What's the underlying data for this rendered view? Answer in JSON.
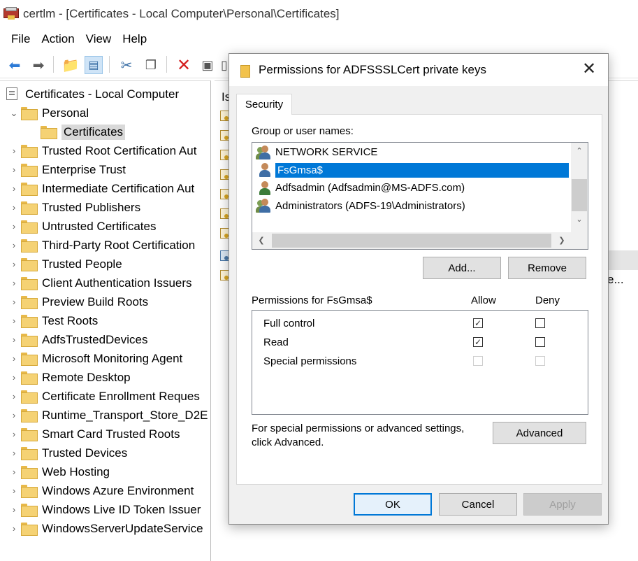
{
  "window": {
    "title": "certlm - [Certificates - Local Computer\\Personal\\Certificates]"
  },
  "menu": [
    "File",
    "Action",
    "View",
    "Help"
  ],
  "tree": {
    "root": "Certificates - Local Computer",
    "personal": "Personal",
    "personal_child": "Certificates",
    "folders": [
      "Trusted Root Certification Aut",
      "Enterprise Trust",
      "Intermediate Certification Aut",
      "Trusted Publishers",
      "Untrusted Certificates",
      "Third-Party Root Certification",
      "Trusted People",
      "Client Authentication Issuers",
      "Preview Build Roots",
      "Test Roots",
      "AdfsTrustedDevices",
      "Microsoft Monitoring Agent",
      "Remote Desktop",
      "Certificate Enrollment Reques",
      "Runtime_Transport_Store_D2E",
      "Smart Card Trusted Roots",
      "Trusted Devices",
      "Web Hosting",
      "Windows Azure Environment",
      "Windows Live ID Token Issuer",
      "WindowsServerUpdateService"
    ]
  },
  "list": {
    "header_fragment": "Is",
    "trailing_fragment": "e..."
  },
  "dialog": {
    "title": "Permissions for ADFSSSLCert private keys",
    "tab": "Security",
    "group_label": "Group or user names:",
    "users": [
      {
        "name": "NETWORK SERVICE",
        "icon": "group-icon",
        "selected": false
      },
      {
        "name": "FsGmsa$",
        "icon": "user-icon",
        "selected": true
      },
      {
        "name": "Adfsadmin (Adfsadmin@MS-ADFS.com)",
        "icon": "user-icon",
        "selected": false
      },
      {
        "name": "Administrators (ADFS-19\\Administrators)",
        "icon": "group-icon",
        "selected": false
      }
    ],
    "add_button": "Add...",
    "remove_button": "Remove",
    "perms_label": "Permissions for FsGmsa$",
    "allow_header": "Allow",
    "deny_header": "Deny",
    "permissions": [
      {
        "name": "Full control",
        "allow": true,
        "deny": false,
        "enabled": true
      },
      {
        "name": "Read",
        "allow": true,
        "deny": false,
        "enabled": true
      },
      {
        "name": "Special permissions",
        "allow": false,
        "deny": false,
        "enabled": false
      }
    ],
    "special_text_line1": "For special permissions or advanced settings,",
    "special_text_line2": "click Advanced.",
    "advanced_button": "Advanced",
    "ok_button": "OK",
    "cancel_button": "Cancel",
    "apply_button": "Apply",
    "close_glyph": "✕"
  },
  "colors": {
    "selection": "#0078d7",
    "folder": "#f5d274"
  }
}
